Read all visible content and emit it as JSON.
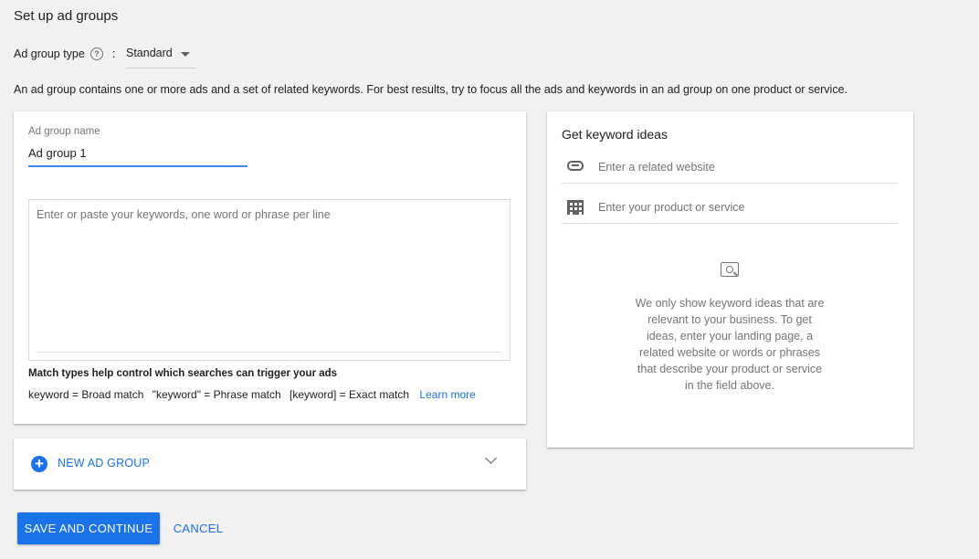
{
  "page": {
    "title": "Set up ad groups",
    "description": "An ad group contains one or more ads and a set of related keywords. For best results, try to focus all the ads and keywords in an ad group on one product or service."
  },
  "ad_group_type": {
    "label": "Ad group type",
    "colon": ":",
    "help_icon": "help-icon",
    "selected": "Standard"
  },
  "ad_group": {
    "name_label": "Ad group name",
    "name_value": "Ad group 1",
    "keywords_placeholder": "Enter or paste your keywords, one word or phrase per line",
    "match_title": "Match types help control which searches can trigger your ads",
    "match_broad": "keyword = Broad match",
    "match_phrase": "\"keyword\" = Phrase match",
    "match_exact": "[keyword] = Exact match",
    "learn_more": "Learn more"
  },
  "new_ad_group": {
    "label": "NEW AD GROUP",
    "icon": "add-circle-icon"
  },
  "keyword_ideas": {
    "title": "Get keyword ideas",
    "website_placeholder": "Enter a related website",
    "product_placeholder": "Enter your product or service",
    "info": "We only show keyword ideas that are relevant to your business. To get ideas, enter your landing page, a related website or words or phrases that describe your product or service in the field above."
  },
  "actions": {
    "save": "SAVE AND CONTINUE",
    "cancel": "CANCEL"
  },
  "colors": {
    "accent": "#1a73e8",
    "background": "#f1f1f1"
  }
}
